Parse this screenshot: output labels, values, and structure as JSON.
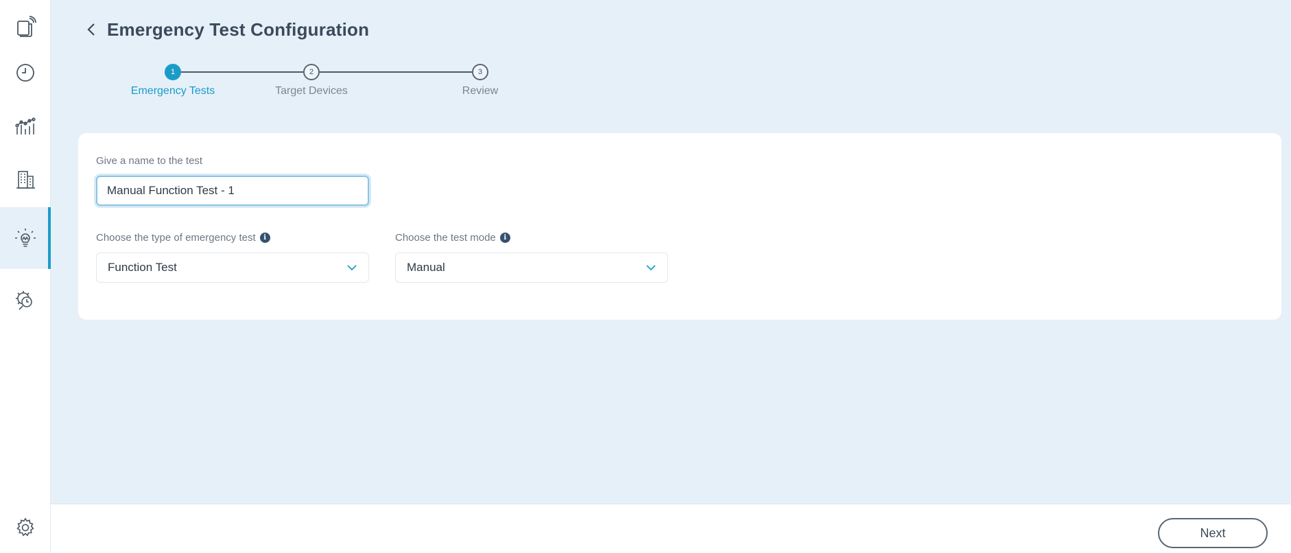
{
  "sidebar": {
    "items": [
      {
        "icon": "device-signal-icon",
        "active": false
      },
      {
        "icon": "clock-icon",
        "active": false
      },
      {
        "icon": "analytics-icon",
        "active": false
      },
      {
        "icon": "building-icon",
        "active": false
      },
      {
        "icon": "emergency-light-icon",
        "active": true
      },
      {
        "icon": "settings-search-icon",
        "active": false
      }
    ],
    "bottom_icon": "gear-icon"
  },
  "header": {
    "title": "Emergency Test Configuration"
  },
  "stepper": {
    "steps": [
      {
        "number": "1",
        "label": "Emergency Tests",
        "active": true
      },
      {
        "number": "2",
        "label": "Target Devices",
        "active": false
      },
      {
        "number": "3",
        "label": "Review",
        "active": false
      }
    ]
  },
  "form": {
    "name_label": "Give a name to the test",
    "name_value": "Manual Function Test - 1",
    "type_label": "Choose the type of emergency test",
    "type_value": "Function Test",
    "mode_label": "Choose the test mode",
    "mode_value": "Manual"
  },
  "footer": {
    "next_label": "Next"
  },
  "colors": {
    "accent": "#1a9cc8",
    "background": "#e6f0f8",
    "text": "#3b4a5c"
  }
}
